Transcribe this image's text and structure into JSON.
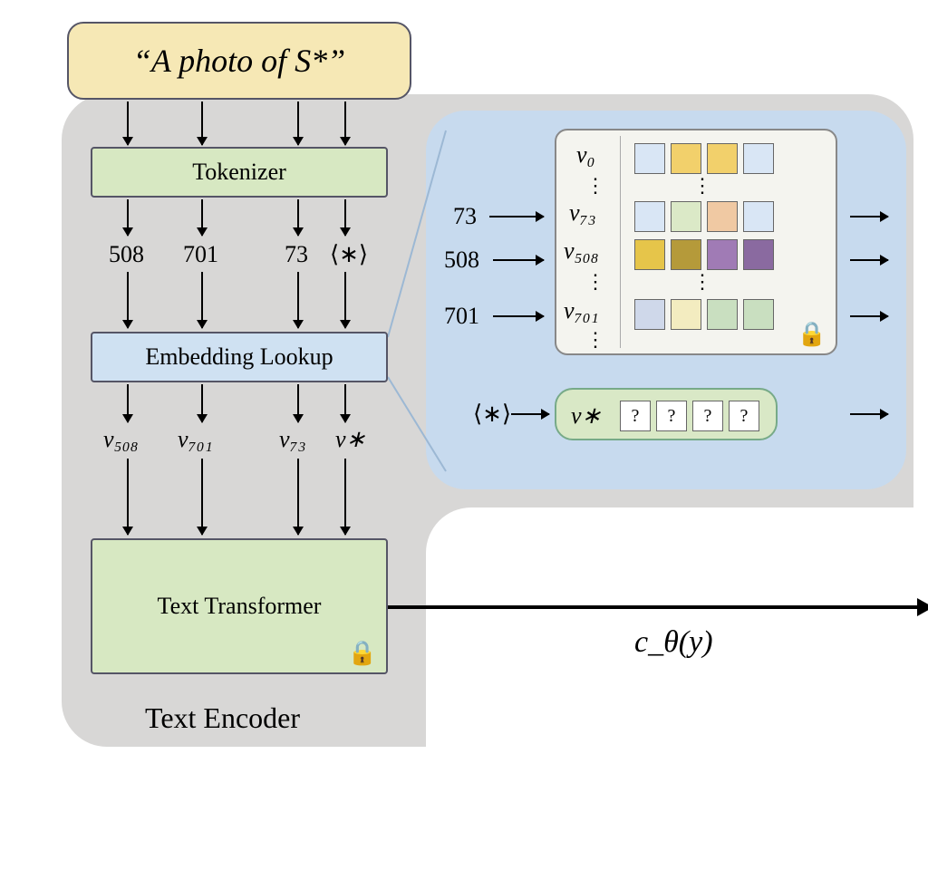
{
  "prompt_text": "“A photo of S*”",
  "blocks": {
    "tokenizer": "Tokenizer",
    "embedding": "Embedding Lookup",
    "transformer": "Text Transformer",
    "encoder_label": "Text Encoder"
  },
  "tokens": {
    "t1": "508",
    "t2": "701",
    "t3": "73",
    "t4": "⟨∗⟩"
  },
  "embeddings_out": {
    "e1": "v₅₀₈",
    "e2": "v₇₀₁",
    "e3": "v₇₃",
    "e4": "v∗"
  },
  "table_inputs": {
    "in1": "73",
    "in2": "508",
    "in3": "701",
    "in_star": "⟨∗⟩"
  },
  "table_rows": {
    "r0": "v₀",
    "r1": "v₇₃",
    "r2": "v₅₀₈",
    "r3": "v₇₀₁",
    "rstar": "v∗"
  },
  "colors": {
    "v0": [
      "#d9e6f5",
      "#f2d06b",
      "#f2d06b",
      "#d9e6f5"
    ],
    "v73": [
      "#d9e6f5",
      "#dbe9c7",
      "#f0c9a3",
      "#d9e6f5"
    ],
    "v508": [
      "#e6c54a",
      "#b59a3a",
      "#a07bb5",
      "#8a6aa0"
    ],
    "v701": [
      "#cfd8ea",
      "#f3ecc0",
      "#c9dfc0",
      "#c9dfc0"
    ]
  },
  "qmarks": [
    "?",
    "?",
    "?",
    "?"
  ],
  "output_label": "c_θ(y)",
  "lock_icon": "🔒"
}
